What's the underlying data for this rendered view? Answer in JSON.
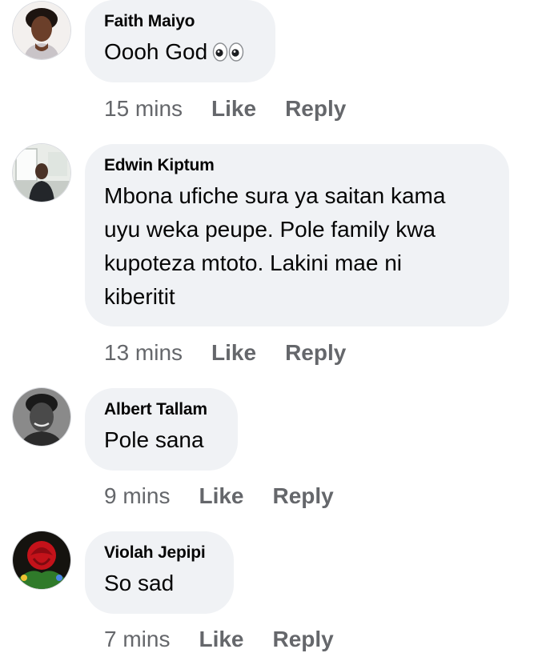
{
  "comments": [
    {
      "author": "Faith Maiyo",
      "text": "Oooh God",
      "emoji_icon": "eyes-icon",
      "time": "15 mins",
      "like_label": "Like",
      "reply_label": "Reply"
    },
    {
      "author": "Edwin Kiptum",
      "text": "Mbona ufiche sura ya saitan kama\nuyu weka peupe. Pole family kwa\nkupoteza mtoto. Lakini mae ni\nkiberitit",
      "time": "13 mins",
      "like_label": "Like",
      "reply_label": "Reply"
    },
    {
      "author": "Albert Tallam",
      "text": "Pole sana",
      "time": "9 mins",
      "like_label": "Like",
      "reply_label": "Reply"
    },
    {
      "author": "Violah Jepipi",
      "text": "So sad",
      "time": "7 mins",
      "like_label": "Like",
      "reply_label": "Reply"
    }
  ],
  "colors": {
    "bubble": "#f0f2f5",
    "name": "#050505",
    "meta": "#65676b"
  }
}
